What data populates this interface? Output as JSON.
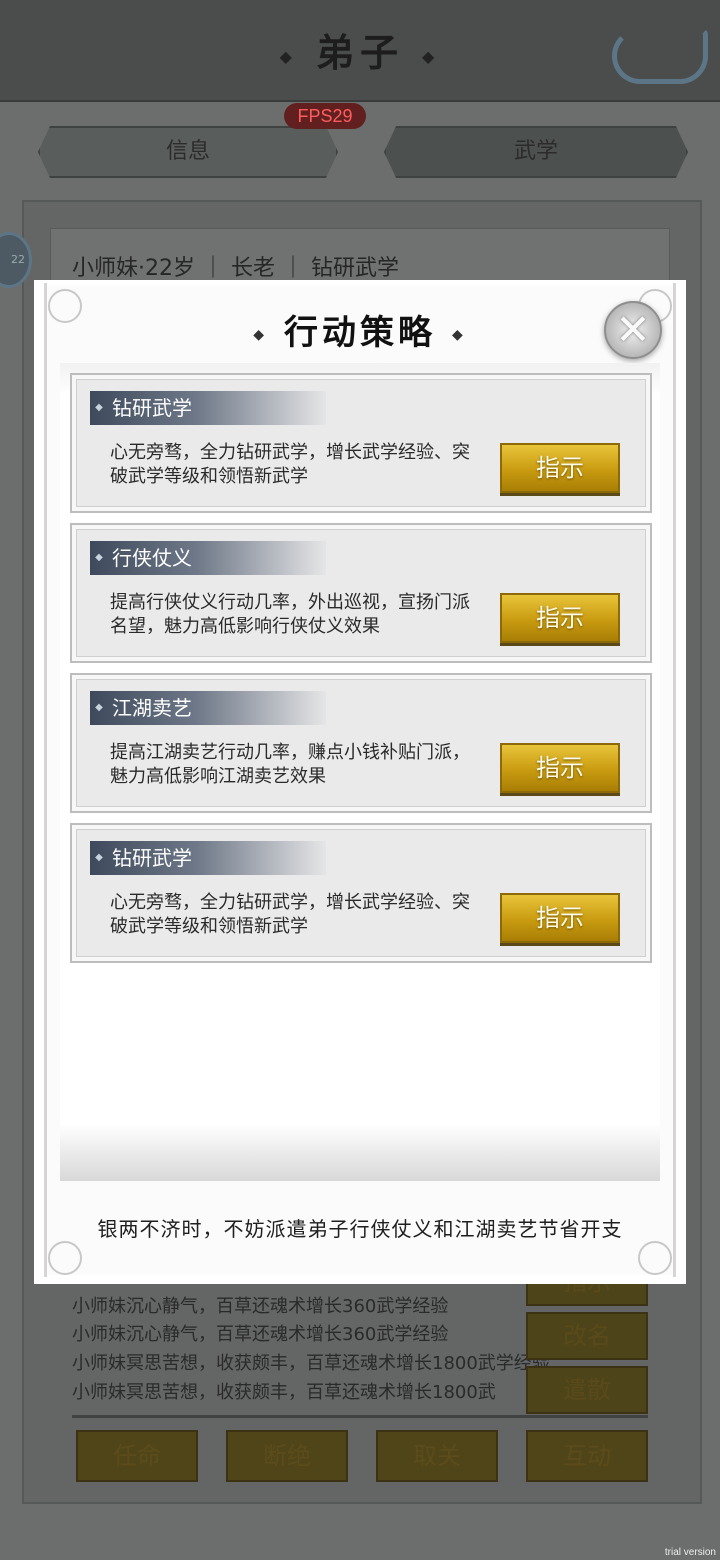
{
  "header": {
    "title": "弟子"
  },
  "fps": "FPS29",
  "tabs": [
    {
      "label": "信息"
    },
    {
      "label": "武学"
    }
  ],
  "avatar_level": "22",
  "profile": {
    "summary": "小师妹·22岁 ｜ 长老 ｜ 钻研武学"
  },
  "log": [
    "小师妹沉心静气，百草还魂术增长360武学经验",
    "小师妹沉心静气，百草还魂术增长360武学经验",
    "小师妹冥思苦想，收获颇丰，百草还魂术增长1800武学经验",
    "小师妹冥思苦想，收获颇丰，百草还魂术增长1800武"
  ],
  "side_buttons": [
    {
      "label": "指示"
    },
    {
      "label": "改名"
    },
    {
      "label": "遣散"
    }
  ],
  "bottom_buttons": [
    {
      "label": "任命"
    },
    {
      "label": "断绝"
    },
    {
      "label": "取关"
    },
    {
      "label": "互动"
    }
  ],
  "modal": {
    "title": "行动策略",
    "strategies": [
      {
        "title": "钻研武学",
        "desc": "心无旁骛，全力钻研武学，增长武学经验、突破武学等级和领悟新武学",
        "button": "指示"
      },
      {
        "title": "行侠仗义",
        "desc": "提高行侠仗义行动几率，外出巡视，宣扬门派名望，魅力高低影响行侠仗义效果",
        "button": "指示"
      },
      {
        "title": "江湖卖艺",
        "desc": "提高江湖卖艺行动几率，赚点小钱补贴门派，魅力高低影响江湖卖艺效果",
        "button": "指示"
      },
      {
        "title": "钻研武学",
        "desc": "心无旁骛，全力钻研武学，增长武学经验、突破武学等级和领悟新武学",
        "button": "指示"
      }
    ],
    "tip": "银两不济时，不妨派遣弟子行侠仗义和江湖卖艺节省开支"
  },
  "watermark": "trial version",
  "icons": {
    "close": "close-icon",
    "back": "back-arrow-icon",
    "tag": "diamond-icon"
  },
  "colors": {
    "gold_button": "#d4a820",
    "tag_dark": "#3e4a5c",
    "fps_text": "#ff5d5d"
  }
}
